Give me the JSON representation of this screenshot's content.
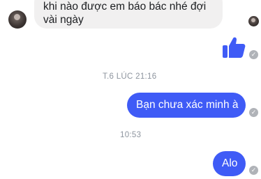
{
  "messages": {
    "incoming_1": {
      "text": "khi nào được em báo bác nhé đợi vài ngày"
    },
    "outgoing_like": {
      "icon": "thumbs-up-icon"
    },
    "divider_1": {
      "text": "T.6 LÚC 21:16"
    },
    "outgoing_1": {
      "text": "Bạn chưa xác minh à"
    },
    "divider_2": {
      "text": "10:53"
    },
    "outgoing_2": {
      "text": "Alo"
    }
  },
  "status_icons": {
    "read": "check-circle-icon",
    "seen_by": "avatar"
  },
  "colors": {
    "accent": "#3f5bf6",
    "incoming_bubble": "#f1f0f0",
    "timestamp": "#8d949e",
    "check": "#b0b3b8"
  }
}
